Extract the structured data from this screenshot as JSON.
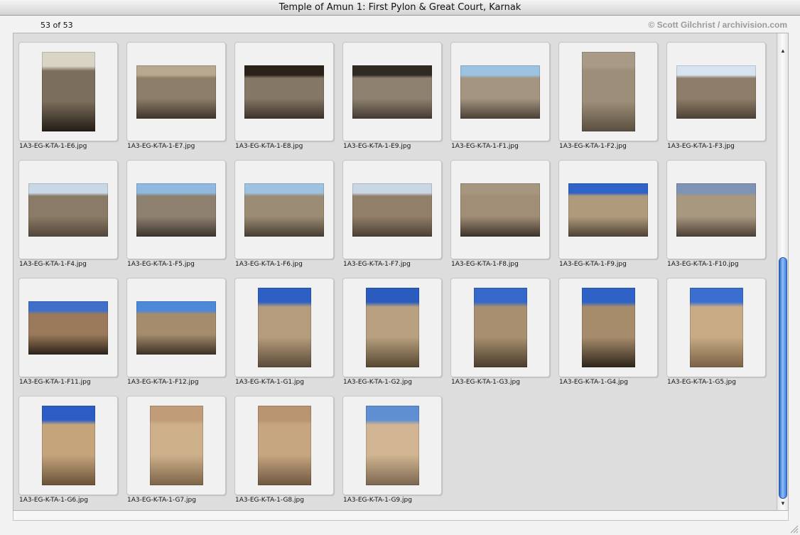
{
  "window": {
    "title": "Temple of Amun 1: First Pylon & Great Court, Karnak"
  },
  "infobar": {
    "counter": "53 of 53",
    "copyright": "© Scott Gilchrist / archivision.com"
  },
  "thumbnails": [
    {
      "file": "1A3-EG-K-TA-1-E6.jpg",
      "orientation": "portrait",
      "sky": "#d9d4c5",
      "stone": "#7a6e5c",
      "dark": "#241d16"
    },
    {
      "file": "1A3-EG-K-TA-1-E7.jpg",
      "orientation": "landscape",
      "sky": "#b7a88f",
      "stone": "#8c7e68",
      "dark": "#3e342a"
    },
    {
      "file": "1A3-EG-K-TA-1-E8.jpg",
      "orientation": "landscape",
      "sky": "#2a2218",
      "stone": "#857766",
      "dark": "#3a3128"
    },
    {
      "file": "1A3-EG-K-TA-1-E9.jpg",
      "orientation": "landscape",
      "sky": "#2f2a22",
      "stone": "#8f8170",
      "dark": "#433a30"
    },
    {
      "file": "1A3-EG-K-TA-1-F1.jpg",
      "orientation": "landscape",
      "sky": "#9cc3e0",
      "stone": "#a39580",
      "dark": "#4a4034"
    },
    {
      "file": "1A3-EG-K-TA-1-F2.jpg",
      "orientation": "portrait",
      "sky": "#a89a86",
      "stone": "#9c8e78",
      "dark": "#5a4e40"
    },
    {
      "file": "1A3-EG-K-TA-1-F3.jpg",
      "orientation": "landscape",
      "sky": "#d7e4ef",
      "stone": "#8e7d68",
      "dark": "#4d4236"
    },
    {
      "file": "1A3-EG-K-TA-1-F4.jpg",
      "orientation": "landscape",
      "sky": "#c9d8e6",
      "stone": "#8a7b66",
      "dark": "#52463a"
    },
    {
      "file": "1A3-EG-K-TA-1-F5.jpg",
      "orientation": "landscape",
      "sky": "#8fb9de",
      "stone": "#8e8170",
      "dark": "#3c342c"
    },
    {
      "file": "1A3-EG-K-TA-1-F6.jpg",
      "orientation": "landscape",
      "sky": "#9ec2e0",
      "stone": "#9b8c76",
      "dark": "#463c31"
    },
    {
      "file": "1A3-EG-K-TA-1-F7.jpg",
      "orientation": "landscape",
      "sky": "#c9d7e4",
      "stone": "#917f6a",
      "dark": "#4a3f33"
    },
    {
      "file": "1A3-EG-K-TA-1-F8.jpg",
      "orientation": "landscape",
      "sky": "#a69680",
      "stone": "#a08e76",
      "dark": "#3b3229"
    },
    {
      "file": "1A3-EG-K-TA-1-F9.jpg",
      "orientation": "landscape",
      "sky": "#2f63c7",
      "stone": "#b09a7c",
      "dark": "#4e4234"
    },
    {
      "file": "1A3-EG-K-TA-1-F10.jpg",
      "orientation": "landscape",
      "sky": "#7f93b6",
      "stone": "#a99880",
      "dark": "#4a4034"
    },
    {
      "file": "1A3-EG-K-TA-1-F11.jpg",
      "orientation": "landscape",
      "sky": "#3f6fc9",
      "stone": "#9a7a5a",
      "dark": "#2c2218"
    },
    {
      "file": "1A3-EG-K-TA-1-F12.jpg",
      "orientation": "landscape",
      "sky": "#4e88d8",
      "stone": "#a58c6c",
      "dark": "#3d3024"
    },
    {
      "file": "1A3-EG-K-TA-1-G1.jpg",
      "orientation": "portrait",
      "sky": "#2d5fc4",
      "stone": "#b59c7c",
      "dark": "#5b4a38"
    },
    {
      "file": "1A3-EG-K-TA-1-G2.jpg",
      "orientation": "portrait",
      "sky": "#2a5bbf",
      "stone": "#b8a080",
      "dark": "#56462f"
    },
    {
      "file": "1A3-EG-K-TA-1-G3.jpg",
      "orientation": "portrait",
      "sky": "#3568c9",
      "stone": "#a88f70",
      "dark": "#4a3c2c"
    },
    {
      "file": "1A3-EG-K-TA-1-G4.jpg",
      "orientation": "portrait",
      "sky": "#2e62c6",
      "stone": "#a78c6c",
      "dark": "#2e241a"
    },
    {
      "file": "1A3-EG-K-TA-1-G5.jpg",
      "orientation": "portrait",
      "sky": "#3a6fd0",
      "stone": "#c8aa84",
      "dark": "#7a6246"
    },
    {
      "file": "1A3-EG-K-TA-1-G6.jpg",
      "orientation": "portrait",
      "sky": "#2b5dc5",
      "stone": "#c5a47c",
      "dark": "#6a5238"
    },
    {
      "file": "1A3-EG-K-TA-1-G7.jpg",
      "orientation": "portrait",
      "sky": "#c09c78",
      "stone": "#cdb08a",
      "dark": "#7d6448"
    },
    {
      "file": "1A3-EG-K-TA-1-G8.jpg",
      "orientation": "portrait",
      "sky": "#b89470",
      "stone": "#c6a680",
      "dark": "#6e5640"
    },
    {
      "file": "1A3-EG-K-TA-1-G9.jpg",
      "orientation": "portrait",
      "sky": "#5f8fd2",
      "stone": "#d1b592",
      "dark": "#7b6650"
    }
  ]
}
